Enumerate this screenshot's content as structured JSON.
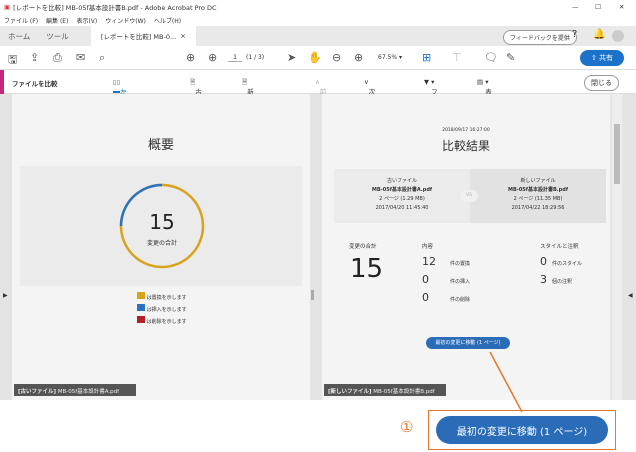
{
  "window": {
    "title": "[レポートを比較] MB-05f基本設計書B.pdf - Adobe Acrobat Pro DC",
    "min": "—",
    "max": "☐",
    "close": "✕"
  },
  "menu": [
    "ファイル (F)",
    "編集 (E)",
    "表示(V)",
    "ウィンドウ(W)",
    "ヘルプ(H)"
  ],
  "tabs": {
    "home": "ホーム",
    "tools": "ツール",
    "doc": "[レポートを比較] MB-0...",
    "doc_close": "×",
    "feedback": "フィードバックを提供"
  },
  "toolbar": {
    "page": "1",
    "page_count": "(1 / 3)",
    "zoom": "67.5%",
    "share": "共有"
  },
  "compare": {
    "title": "ファイルを比較",
    "side_by_side": "左右に並べて表示",
    "old_file": "古いファイル",
    "new_file": "新しいファイル",
    "prev": "前の変更",
    "next": "次の変更",
    "filter": "フィルター",
    "view": "表示",
    "close": "閉じる"
  },
  "left": {
    "heading": "概要",
    "total": "15",
    "total_label": "変更の合計",
    "legend": [
      "は置換を示します",
      "は挿入を示します",
      "は削除を示します"
    ],
    "footer_tag": "[古いファイル]",
    "footer_name": "MB-05f基本設計書A.pdf"
  },
  "right": {
    "timestamp": "2018/09/17 16:27:00",
    "heading": "比較結果",
    "old": {
      "label": "古いファイル",
      "name": "MB-05f基本設計書A.pdf",
      "pages": "2 ページ (1.29 MB)",
      "date": "2017/04/20 11:45:40"
    },
    "vs": "VS",
    "new": {
      "label": "新しいファイル",
      "name": "MB-05f基本設計書B.pdf",
      "pages": "2 ページ (11.35 MB)",
      "date": "2017/04/22 18:29:56"
    },
    "total_label": "変更の合計",
    "total": "15",
    "content_label": "内容",
    "content": [
      {
        "n": "12",
        "label": "件の置換"
      },
      {
        "n": "0",
        "label": "件の挿入"
      },
      {
        "n": "0",
        "label": "件の削除"
      }
    ],
    "style_label": "スタイルと注釈",
    "style": [
      {
        "n": "0",
        "label": "件のスタイル"
      },
      {
        "n": "3",
        "label": "個の注釈"
      }
    ],
    "goto": "最初の変更に移動 (1 ページ)",
    "footer_tag": "[新しいファイル]",
    "footer_name": "MB-05f基本設計書B.pdf"
  },
  "callout": {
    "number": "①",
    "button": "最初の変更に移動 (1 ページ)"
  },
  "colors": {
    "accent": "#1a73c8",
    "replace": "#d9a21b",
    "insert": "#2a72c0",
    "delete": "#b2202a",
    "callout": "#e5762b"
  }
}
